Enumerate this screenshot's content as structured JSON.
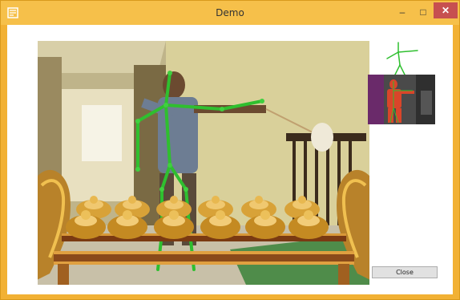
{
  "window": {
    "title": "Demo",
    "minimize_glyph": "–",
    "maximize_glyph": "□",
    "close_glyph": "✕"
  },
  "icons": {
    "app": "app-icon",
    "skeleton": "skeleton-icon"
  },
  "colors": {
    "frame": "#f2b134",
    "titlebar": "#f6c04a",
    "skeleton": "#2fbf2f",
    "close_hover": "#c75050"
  },
  "buttons": {
    "close_label": "Close"
  }
}
